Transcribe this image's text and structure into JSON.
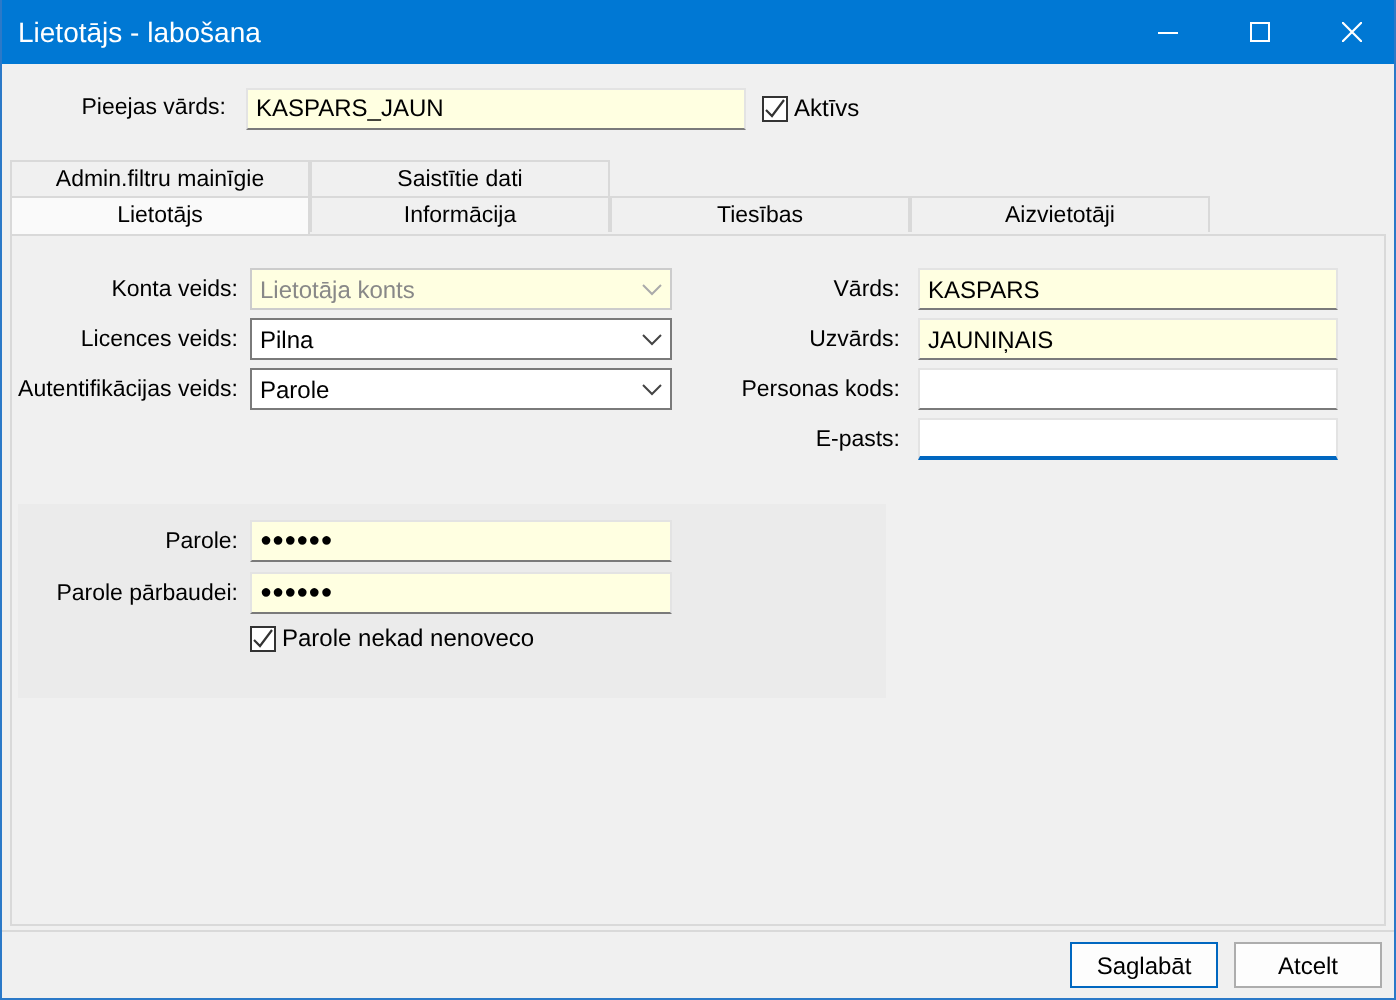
{
  "window": {
    "title": "Lietotājs - labošana"
  },
  "login": {
    "label": "Pieejas vārds:",
    "value": "KASPARS_JAUN",
    "required": true,
    "active": {
      "label": "Aktīvs",
      "checked": true
    }
  },
  "tab_rows": [
    [
      {
        "label": "Admin.filtru mainīgie",
        "selected": false
      },
      {
        "label": "Saistītie dati",
        "selected": false
      }
    ],
    [
      {
        "label": "Lietotājs",
        "selected": true
      },
      {
        "label": "Informācija",
        "selected": false
      },
      {
        "label": "Tiesības",
        "selected": false
      },
      {
        "label": "Aizvietotāji",
        "selected": false
      }
    ]
  ],
  "left_fields": [
    {
      "label": "Konta veids:",
      "kind": "combo",
      "value": "Lietotāja konts",
      "required": true,
      "disabled": true
    },
    {
      "label": "Licences veids:",
      "kind": "combo",
      "value": "Pilna",
      "required": false,
      "disabled": false
    },
    {
      "label": "Autentifikācijas veids:",
      "kind": "combo",
      "value": "Parole",
      "required": false,
      "disabled": false
    }
  ],
  "right_fields": [
    {
      "label": "Vārds:",
      "value": "KASPARS",
      "required": true,
      "focused": false
    },
    {
      "label": "Uzvārds:",
      "value": "JAUNIŅAIS",
      "required": true,
      "focused": false
    },
    {
      "label": "Personas kods:",
      "required": false,
      "focused": false
    },
    {
      "label": "E-pasts:",
      "required": false,
      "focused": true
    }
  ],
  "password_group": {
    "fields": [
      {
        "label": "Parole:",
        "value": "●●●●●●",
        "required": true
      },
      {
        "label": "Parole pārbaudei:",
        "value": "●●●●●●",
        "required": true
      }
    ],
    "never_expires": {
      "label": "Parole nekad nenoveco",
      "checked": true
    }
  },
  "buttons": [
    {
      "label": "Saglabāt",
      "default": true
    },
    {
      "label": "Atcelt",
      "default": false
    }
  ]
}
